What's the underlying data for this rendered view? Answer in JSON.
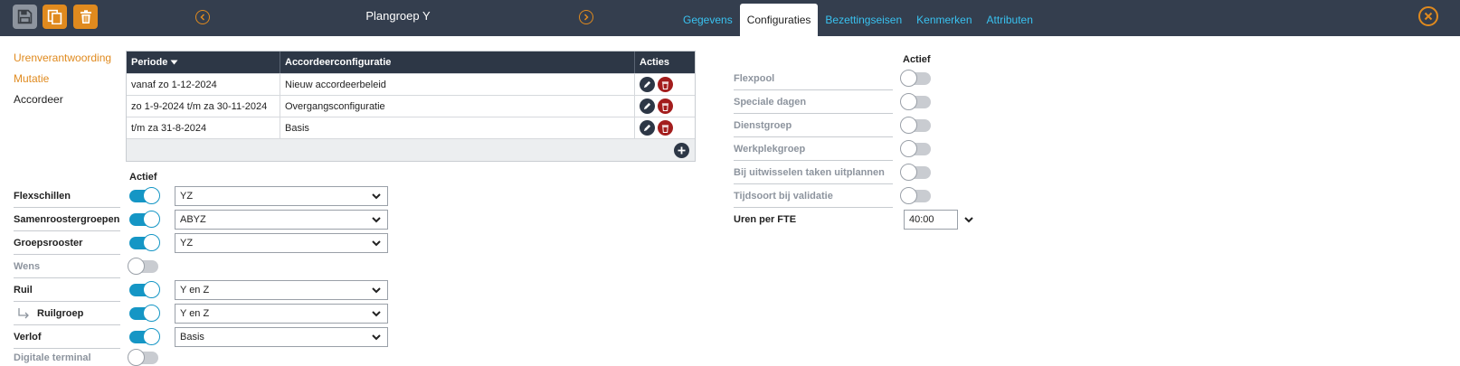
{
  "header": {
    "title": "Plangroep Y",
    "tabs": [
      {
        "label": "Gegevens",
        "active": false
      },
      {
        "label": "Configuraties",
        "active": true
      },
      {
        "label": "Bezettingseisen",
        "active": false
      },
      {
        "label": "Kenmerken",
        "active": false
      },
      {
        "label": "Attributen",
        "active": false
      }
    ]
  },
  "side_menu": {
    "items": [
      {
        "label": "Urenverantwoording",
        "style": "link"
      },
      {
        "label": "Mutatie",
        "style": "link"
      },
      {
        "label": "Accordeer",
        "style": "plain"
      }
    ]
  },
  "table": {
    "columns": {
      "periode": "Periode",
      "config": "Accordeerconfiguratie",
      "acties": "Acties"
    },
    "rows": [
      {
        "periode": "vanaf zo 1-12-2024",
        "config": "Nieuw accordeerbeleid"
      },
      {
        "periode": "zo 1-9-2024 t/m za 30-11-2024",
        "config": "Overgangsconfiguratie"
      },
      {
        "periode": "t/m za 31-8-2024",
        "config": "Basis"
      }
    ]
  },
  "left_settings": {
    "actief_header": "Actief",
    "rows": [
      {
        "label": "Flexschillen",
        "on": true,
        "muted": false,
        "select": "YZ"
      },
      {
        "label": "Samenroostergroepen",
        "on": true,
        "muted": false,
        "select": "ABYZ"
      },
      {
        "label": "Groepsrooster",
        "on": true,
        "muted": false,
        "select": "YZ"
      },
      {
        "label": "Wens",
        "on": false,
        "muted": true,
        "select": null
      },
      {
        "label": "Ruil",
        "on": true,
        "muted": false,
        "select": "Y en Z"
      },
      {
        "label": "Ruilgroep",
        "on": true,
        "muted": false,
        "select": "Y en Z",
        "sub": true
      },
      {
        "label": "Verlof",
        "on": true,
        "muted": false,
        "select": "Basis"
      },
      {
        "label": "Digitale terminal",
        "on": false,
        "muted": true,
        "select": null
      }
    ]
  },
  "right_settings": {
    "actief_header": "Actief",
    "rows": [
      {
        "label": "Flexpool",
        "on": false
      },
      {
        "label": "Speciale dagen",
        "on": false
      },
      {
        "label": "Dienstgroep",
        "on": false
      },
      {
        "label": "Werkplekgroep",
        "on": false
      },
      {
        "label": "Bij uitwisselen taken uitplannen",
        "on": false
      },
      {
        "label": "Tijdsoort bij validatie",
        "on": false
      }
    ],
    "fte": {
      "label": "Uren per FTE",
      "value": "40:00"
    }
  },
  "colors": {
    "topbar": "#343e4e",
    "accent_orange": "#e08a1e",
    "tab_link": "#39c2f0",
    "toggle_on": "#1596c5",
    "delete_red": "#a31d1d"
  },
  "icons": {
    "save": "save-icon",
    "copy": "copy-icon",
    "trash": "trash-icon",
    "prev": "chevron-left-icon",
    "next": "chevron-right-icon",
    "close": "close-icon",
    "edit": "pencil-icon",
    "delete": "trash-icon",
    "add": "plus-icon",
    "sort": "caret-down-icon",
    "dropdown": "chevron-down-icon"
  }
}
